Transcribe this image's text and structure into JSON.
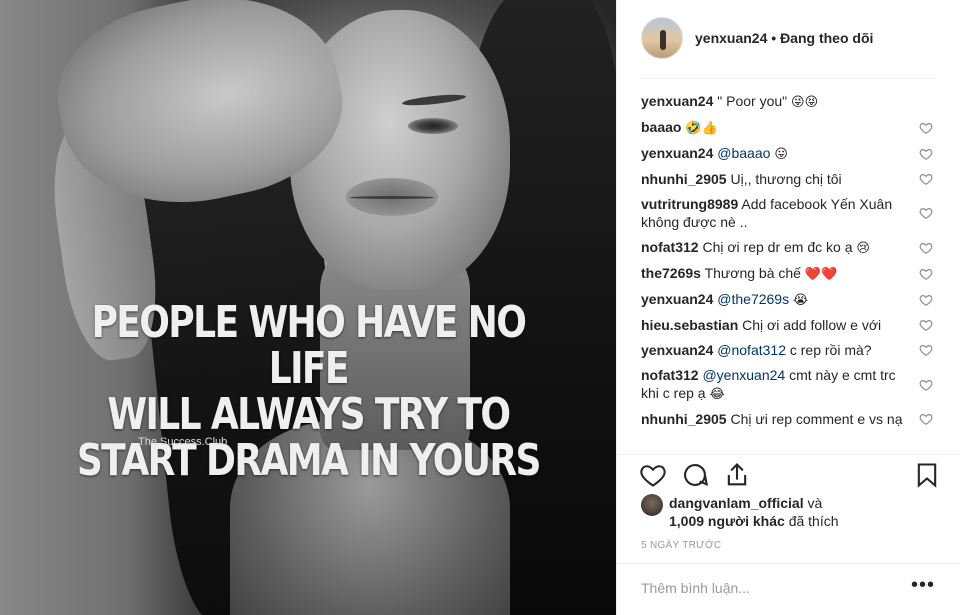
{
  "photo": {
    "quote_lines": [
      "PEOPLE WHO HAVE NO LIFE",
      "WILL ALWAYS TRY TO",
      "START DRAMA IN YOURS"
    ],
    "watermark": "The.Success.Club"
  },
  "header": {
    "username": "yenxuan24",
    "separator": " • ",
    "follow_status": "Đang theo dõi"
  },
  "comments": [
    {
      "user": "yenxuan24",
      "text": "\" Poor you\"",
      "emoji": "😜😝",
      "like_icon": false
    },
    {
      "user": "baaao",
      "text": "",
      "emoji": "🤣👍",
      "like_icon": true
    },
    {
      "user": "yenxuan24",
      "mention": "@baaao",
      "text": "",
      "emoji": "😛",
      "like_icon": true
    },
    {
      "user": "nhunhi_2905",
      "text": "Uị,, thương chị tôi",
      "emoji": "",
      "like_icon": true
    },
    {
      "user": "vutritrung8989",
      "text": "Add facebook Yến Xuân không được nè ..",
      "emoji": "",
      "like_icon": true
    },
    {
      "user": "nofat312",
      "text": "Chị ơi rep dr em đc ko ạ",
      "emoji": "😢",
      "like_icon": true
    },
    {
      "user": "the7269s",
      "text": "Thương bà chế",
      "emoji": "❤️❤️",
      "like_icon": true
    },
    {
      "user": "yenxuan24",
      "mention": "@the7269s",
      "text": "",
      "emoji": "😭",
      "like_icon": true
    },
    {
      "user": "hieu.sebastian",
      "text": "Chị ơi add follow e với",
      "emoji": "",
      "like_icon": true
    },
    {
      "user": "yenxuan24",
      "mention": "@nofat312",
      "text": "c rep rồi mà?",
      "emoji": "",
      "like_icon": true
    },
    {
      "user": "nofat312",
      "mention": "@yenxuan24",
      "text": "cmt này e cmt trc khi c rep ạ",
      "emoji": "😂",
      "like_icon": true
    },
    {
      "user": "nhunhi_2905",
      "text": "Chị ưi rep comment e vs nạ",
      "emoji": "",
      "like_icon": true
    }
  ],
  "actions": {
    "like": "heart-outline-icon",
    "comment": "comment-bubble-icon",
    "share": "share-icon",
    "save": "bookmark-icon"
  },
  "likes": {
    "first_user": "dangvanlam_official",
    "and": " và",
    "others": "1,009 người khác",
    "liked": " đã thích"
  },
  "date": "5 NGÀY TRƯỚC",
  "add_comment": {
    "placeholder": "Thêm bình luận...",
    "more": "•••"
  },
  "colors": {
    "text": "#262626",
    "mention": "#003569",
    "muted": "#999999",
    "divider": "#efefef"
  }
}
